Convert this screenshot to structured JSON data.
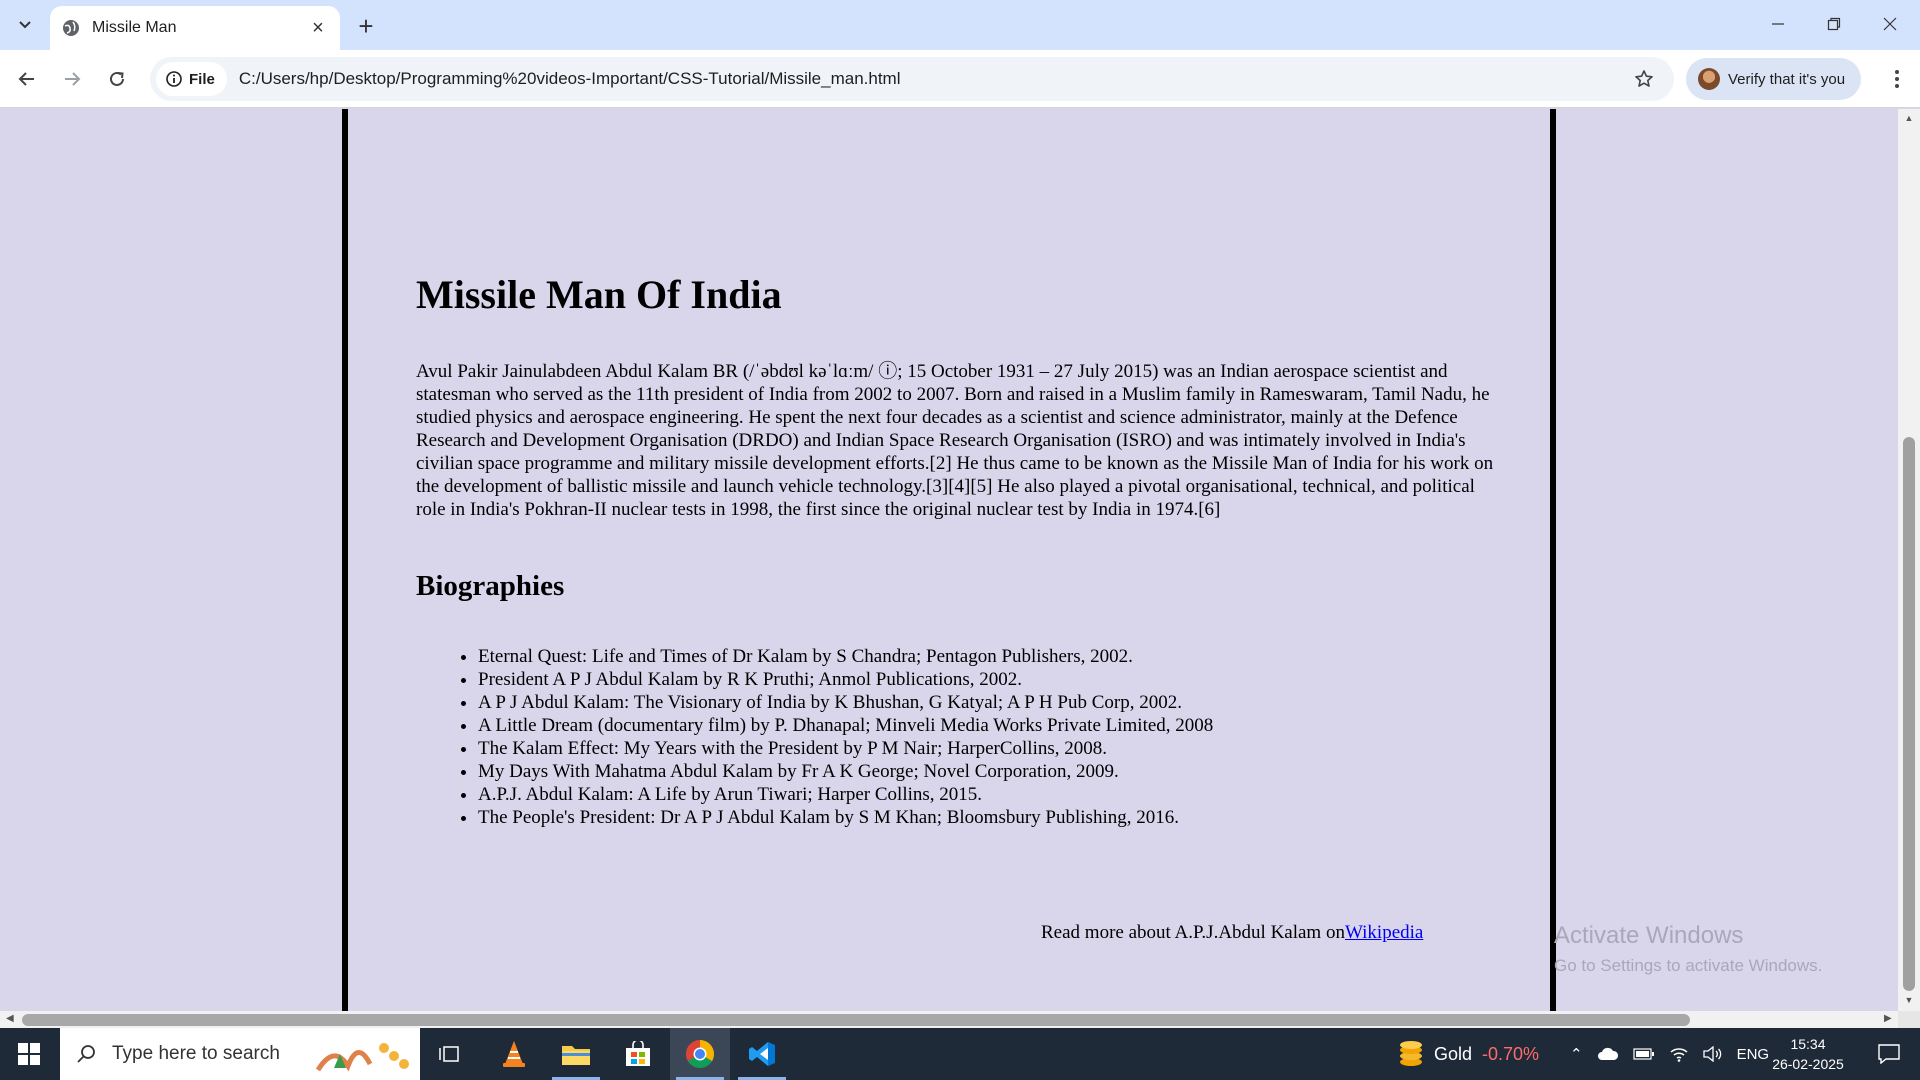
{
  "browser": {
    "tab_title": "Missile Man",
    "site_chip_label": "File",
    "url": "C:/Users/hp/Desktop/Programming%20videos-Important/CSS-Tutorial/Missile_man.html",
    "verify_label": "Verify that it's you"
  },
  "page": {
    "heading": "Missile Man Of India",
    "intro": "Avul Pakir Jainulabdeen Abdul Kalam BR (/ˈəbdʊl kəˈlɑːm/ ⓘ; 15 October 1931 – 27 July 2015) was an Indian aerospace scientist and statesman who served as the 11th president of India from 2002 to 2007. Born and raised in a Muslim family in Rameswaram, Tamil Nadu, he studied physics and aerospace engineering. He spent the next four decades as a scientist and science administrator, mainly at the Defence Research and Development Organisation (DRDO) and Indian Space Research Organisation (ISRO) and was intimately involved in India's civilian space programme and military missile development efforts.[2] He thus came to be known as the Missile Man of India for his work on the development of ballistic missile and launch vehicle technology.[3][4][5] He also played a pivotal organisational, technical, and political role in India's Pokhran-II nuclear tests in 1998, the first since the original nuclear test by India in 1974.[6]",
    "subheading": "Biographies",
    "biographies": [
      "Eternal Quest: Life and Times of Dr Kalam by S Chandra; Pentagon Publishers, 2002.",
      "President A P J Abdul Kalam by R K Pruthi; Anmol Publications, 2002.",
      "A P J Abdul Kalam: The Visionary of India by K Bhushan, G Katyal; A P H Pub Corp, 2002.",
      "A Little Dream (documentary film) by P. Dhanapal; Minveli Media Works Private Limited, 2008",
      "The Kalam Effect: My Years with the President by P M Nair; HarperCollins, 2008.",
      "My Days With Mahatma Abdul Kalam by Fr A K George; Novel Corporation, 2009.",
      "A.P.J. Abdul Kalam: A Life by Arun Tiwari; Harper Collins, 2015.",
      "The People's President: Dr A P J Abdul Kalam by S M Khan; Bloomsbury Publishing, 2016."
    ],
    "read_more_text": "Read more about A.P.J.Abdul Kalam on",
    "read_more_link": "Wikipedia"
  },
  "watermark": {
    "title": "Activate Windows",
    "subtitle": "Go to Settings to activate Windows."
  },
  "taskbar": {
    "search_placeholder": "Type here to search",
    "gold_label": "Gold",
    "gold_change": "-0.70%",
    "language": "ENG",
    "time": "15:34",
    "date": "26-02-2025"
  },
  "colors": {
    "page_background": "#d9d6ec",
    "link": "#0000ee",
    "tabbar": "#d3e3fd",
    "taskbar": "#1f2a38",
    "gold_negative": "#ff6b6b"
  }
}
